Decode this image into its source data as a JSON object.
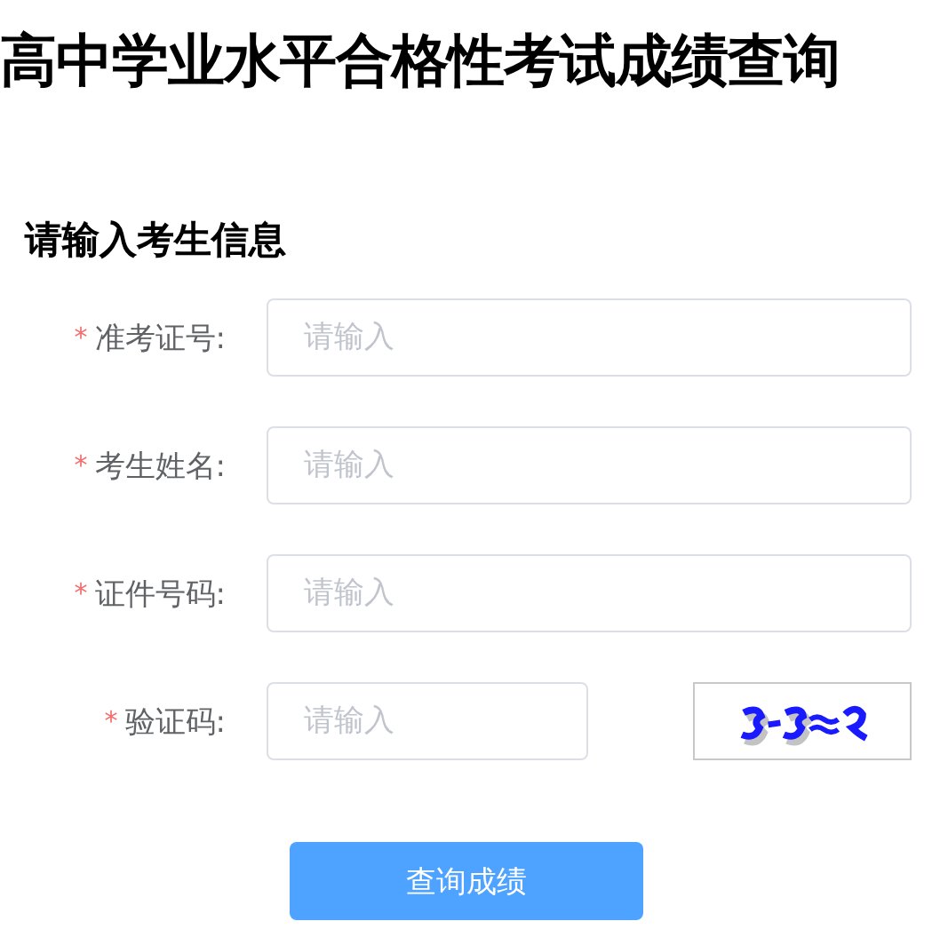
{
  "title": "高中学业水平合格性考试成绩查询",
  "section_heading": "请输入考生信息",
  "fields": [
    {
      "kind": "text",
      "mark": "*",
      "label": "准考证号:",
      "placeholder": "请输入"
    },
    {
      "kind": "text",
      "mark": "*",
      "label": "考生姓名:",
      "placeholder": "请输入"
    },
    {
      "kind": "text",
      "mark": "*",
      "label": "证件号码:",
      "placeholder": "请输入"
    },
    {
      "kind": "captcha",
      "mark": "*",
      "label": "验证码:",
      "placeholder": "请输入"
    }
  ],
  "submit_button": "查询成绩"
}
